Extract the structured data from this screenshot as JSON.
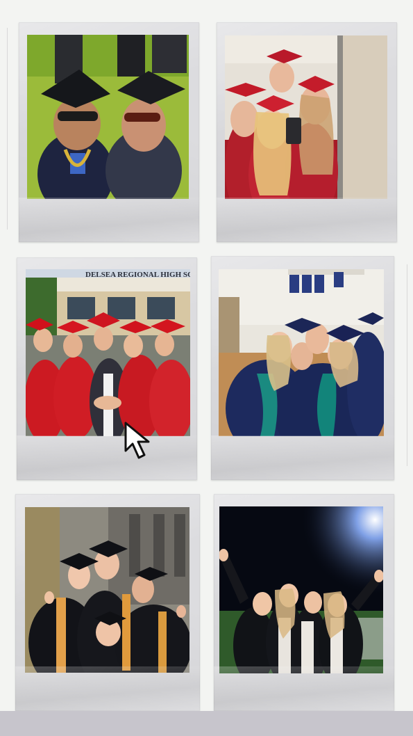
{
  "photos": [
    {
      "id": "photo-1",
      "scene": "two graduates in black caps and sunglasses, low-angle selfie on green lawn"
    },
    {
      "id": "photo-2",
      "scene": "four graduates in red caps and gowns taking a mirror selfie"
    },
    {
      "id": "photo-3",
      "scene": "group of graduates in red gowns in front of school building",
      "sign_text": "DELSEA REGIONAL HIGH SCHOOL"
    },
    {
      "id": "photo-4",
      "scene": "graduates in navy gowns hugging inside a gymnasium"
    },
    {
      "id": "photo-5",
      "scene": "graduates in black gowns with gold stoles in front of gothic building"
    },
    {
      "id": "photo-6",
      "scene": "graduates in black gowns cheering on a football field at night"
    }
  ],
  "colors": {
    "background": "#f3f4f2",
    "frame": "#dcdcdf",
    "band": "#c7c5cc",
    "red_gown": "#c8141e",
    "navy_gown": "#1c2a5a"
  },
  "icons": [
    "cursor-arrow-icon"
  ]
}
